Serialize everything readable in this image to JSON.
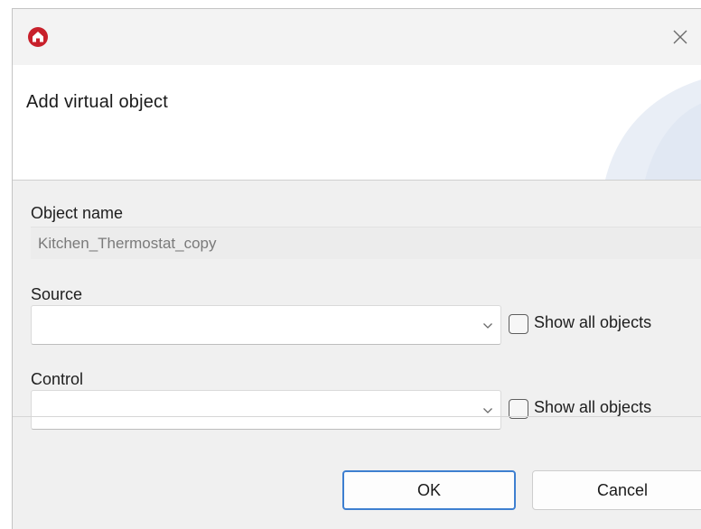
{
  "window": {
    "app_icon": "home-icon",
    "close_icon": "close-icon"
  },
  "header": {
    "title": "Add virtual object"
  },
  "form": {
    "object_name": {
      "label": "Object name",
      "value": "Kitchen_Thermostat_copy"
    },
    "source": {
      "label": "Source",
      "value": "",
      "show_all_label": "Show all objects",
      "show_all_checked": false
    },
    "control": {
      "label": "Control",
      "value": "",
      "show_all_label": "Show all objects",
      "show_all_checked": false
    }
  },
  "footer": {
    "ok_label": "OK",
    "cancel_label": "Cancel"
  },
  "colors": {
    "app_icon_bg": "#c8202b",
    "ok_border": "#3e7fd0",
    "dialog_bg": "#f0f0f0"
  }
}
